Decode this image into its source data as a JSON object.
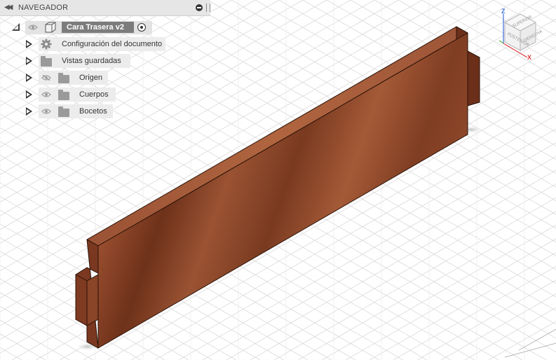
{
  "browser": {
    "title": "NAVEGADOR",
    "root": {
      "label": "Cara Trasera v2"
    },
    "items": [
      {
        "label": "Configuración del documento",
        "icon": "gear-icon"
      },
      {
        "label": "Vistas guardadas",
        "icon": "folder-icon"
      },
      {
        "label": "Origen",
        "icon": "folder-icon",
        "visibility": "hidden"
      },
      {
        "label": "Cuerpos",
        "icon": "folder-icon",
        "visibility": "visible"
      },
      {
        "label": "Bocetos",
        "icon": "folder-icon",
        "visibility": "visible"
      }
    ]
  },
  "viewcube": {
    "faces": {
      "top": "SUPERIOR",
      "front": "POSTERIOR",
      "right": "DERECHA"
    },
    "axes": {
      "x": "X",
      "z": "Z"
    },
    "colors": {
      "x": "#e0393e",
      "z": "#3a6fd8",
      "y": "#55b34d"
    }
  },
  "model": {
    "material": "wood",
    "colors": {
      "top": "#a5553a",
      "front": "#8e4528",
      "side": "#6a2f1a"
    }
  }
}
